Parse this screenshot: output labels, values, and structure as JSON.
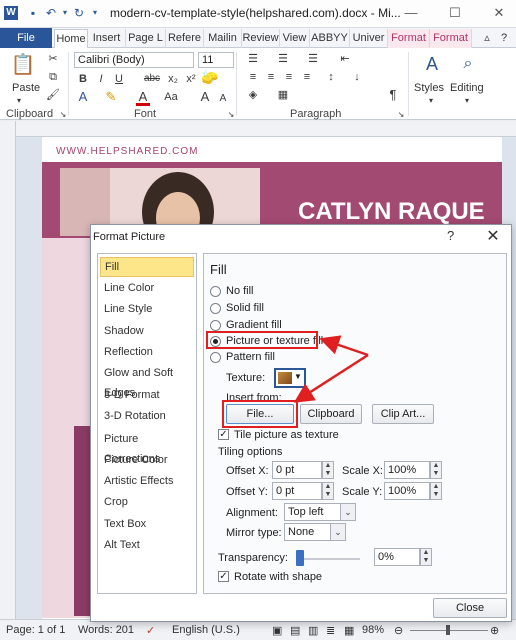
{
  "window": {
    "title": "modern-cv-template-style(helpshared.com).docx - Mi..."
  },
  "tabs": [
    "File",
    "Home",
    "Insert",
    "Page L",
    "Refere",
    "Mailin",
    "Review",
    "View",
    "ABBYY",
    "Univer",
    "Format",
    "Format"
  ],
  "ribbon": {
    "clipboard": {
      "paste": "Paste",
      "label": "Clipboard"
    },
    "font": {
      "name": "Calibri (Body)",
      "size": "11",
      "label": "Font",
      "bold": "B",
      "italic": "I",
      "underline": "U",
      "strike": "abc",
      "sub": "x₂",
      "sup": "x²",
      "color_a": "A",
      "case": "Aa",
      "grow": "A",
      "shrink": "A"
    },
    "paragraph": {
      "label": "Paragraph",
      "pilcrow": "¶"
    },
    "styles": {
      "label": "Styles"
    },
    "editing": {
      "label": "Editing"
    }
  },
  "document": {
    "website": "WWW.HELPSHARED.COM",
    "name": "CATLYN RAQUE"
  },
  "dialog": {
    "title": "Format Picture",
    "help": "?",
    "close_x": "✕",
    "categories": [
      "Fill",
      "Line Color",
      "Line Style",
      "Shadow",
      "Reflection",
      "Glow and Soft Edges",
      "3-D Format",
      "3-D Rotation",
      "Picture Corrections",
      "Picture Color",
      "Artistic Effects",
      "Crop",
      "Text Box",
      "Alt Text"
    ],
    "selected_category": "Fill",
    "panel": {
      "heading": "Fill",
      "options": [
        "No fill",
        "Solid fill",
        "Gradient fill",
        "Picture or texture fill",
        "Pattern fill"
      ],
      "selected_option": "Picture or texture fill",
      "texture_label": "Texture:",
      "insert_from_label": "Insert from:",
      "file_button": "File...",
      "clipboard_button": "Clipboard",
      "clipart_button": "Clip Art...",
      "tile_checkbox": "Tile picture as texture",
      "tiling_label": "Tiling options",
      "offset_x_label": "Offset X:",
      "offset_x_value": "0 pt",
      "scale_x_label": "Scale X:",
      "scale_x_value": "100%",
      "offset_y_label": "Offset Y:",
      "offset_y_value": "0 pt",
      "scale_y_label": "Scale Y:",
      "scale_y_value": "100%",
      "alignment_label": "Alignment:",
      "alignment_value": "Top left",
      "mirror_label": "Mirror type:",
      "mirror_value": "None",
      "transparency_label": "Transparency:",
      "transparency_value": "0%",
      "rotate_checkbox": "Rotate with shape"
    },
    "close_button": "Close"
  },
  "statusbar": {
    "page": "Page: 1 of 1",
    "words": "Words: 201",
    "language": "English (U.S.)",
    "zoom": "98%"
  },
  "colors": {
    "file_tab": "#2a5699",
    "accent_pink": "#a34a72",
    "highlight_red": "#e02020",
    "selected_category": "#fde58a"
  }
}
